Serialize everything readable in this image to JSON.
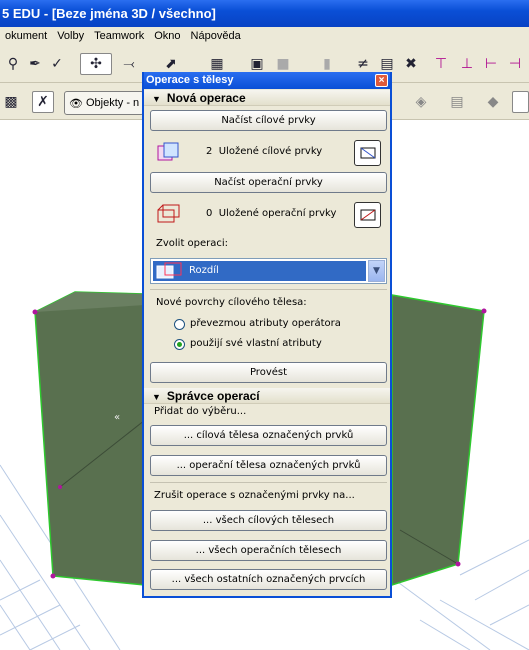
{
  "window": {
    "title": "5 EDU - [Beze jména 3D / všechno]"
  },
  "menu": [
    "okument",
    "Volby",
    "Teamwork",
    "Okno",
    "Nápověda"
  ],
  "toolbar2": {
    "objects_label": "Objekty - n"
  },
  "palette": {
    "title": "Operace s tělesy",
    "close_glyph": "×",
    "new_op": {
      "header": "Nová operace",
      "load_targets_btn": "Načíst cílové prvky",
      "target_count": "2",
      "target_label": "Uložené cílové prvky",
      "load_operators_btn": "Načíst operační prvky",
      "operator_count": "0",
      "operator_label": "Uložené operační prvky",
      "choose_op_label": "Zvolit operaci:",
      "operation_selected": "Rozdíl",
      "new_surfaces_label": "Nové povrchy cílového tělesa:",
      "radio_options": [
        {
          "label": "převezmou atributy operátora",
          "checked": false
        },
        {
          "label": "použijí své vlastní atributy",
          "checked": true
        }
      ],
      "execute_btn": "Provést"
    },
    "manager": {
      "header": "Správce operací",
      "add_label": "Přidat do výběru...",
      "add_targets_btn": "... cílová tělesa označených prvků",
      "add_operators_btn": "... operační tělesa označených prvků",
      "remove_label": "Zrušit operace s označenými prvky na...",
      "remove_targets_btn": "... všech cílových tělesech",
      "remove_operators_btn": "... všech operačních tělesech",
      "remove_others_btn": "... všech ostatních označených prvcích"
    }
  },
  "colors": {
    "titlebar": "#0a4fd6",
    "body_fill": "#59704f",
    "body_edge": "#2ec82e",
    "vertex": "#b0169e",
    "grid": "#b7c9e4",
    "selection": "#316ac5"
  }
}
